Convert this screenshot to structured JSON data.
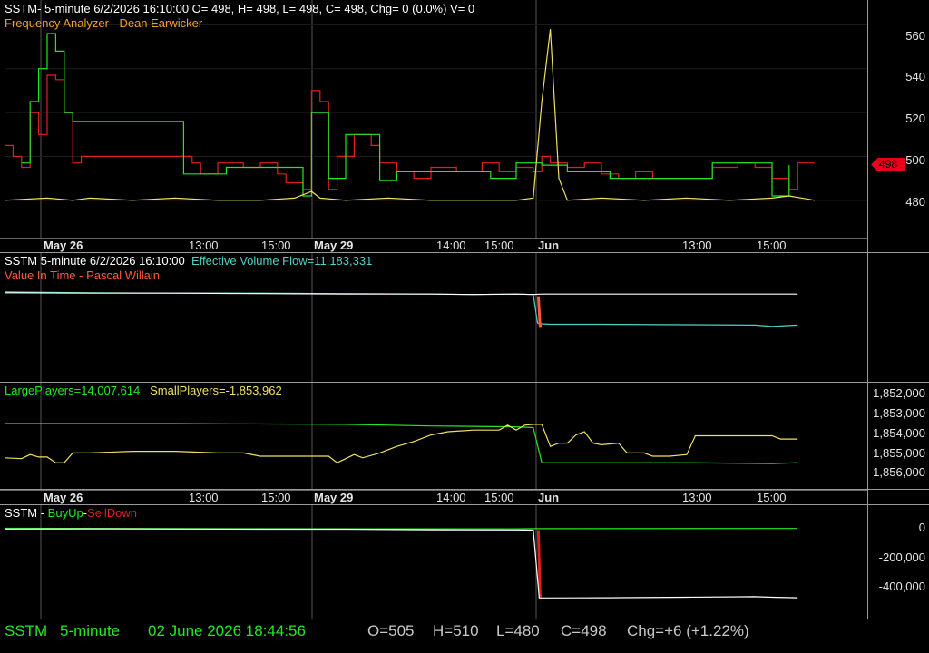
{
  "colors": {
    "background": "#000000",
    "green": "#22e822",
    "red": "#e02020",
    "yellow": "#f0e060",
    "orange": "#f0a030",
    "cyan": "#4fd1c5",
    "white": "#ffffff",
    "grid": "#555555",
    "salmon": "#ff5a3c"
  },
  "header": {
    "title_line": "SSTM- 5-minute 6/2/2026 16:10:00 O= 498, H= 498, L= 498, C= 498, Chg= 0 (0.0%) V= 0",
    "subtitle": "Frequency Analyzer - Dean Earwicker"
  },
  "pane2": {
    "line1_symbol": "SSTM 5-minute  6/2/2026 16:10:00",
    "line1_indicator": "Effective Volume Flow=11,183,331",
    "line2": "Value In Time - Pascal Willain"
  },
  "pane3": {
    "large_label": "LargePlayers=14,007,614",
    "small_label": "SmallPlayers=-1,853,962"
  },
  "pane4": {
    "symbol": "SSTM - ",
    "buyup": "BuyUp",
    "dash": "-",
    "selldown": "SellDown"
  },
  "price_axis": {
    "ticks": [
      "560",
      "540",
      "520",
      "500",
      "480"
    ],
    "last_price": "498"
  },
  "players_axis": {
    "ticks": [
      "1,852,000",
      "1,853,000",
      "1,854,000",
      "1,855,000",
      "1,856,000"
    ]
  },
  "buysell_axis": {
    "ticks": [
      "0",
      "-200,000",
      "-400,000"
    ]
  },
  "x_axis_labels": [
    "May 26",
    "13:00",
    "15:00",
    "May 29",
    "14:00",
    "15:00",
    "Jun",
    "13:00",
    "15:00"
  ],
  "status_bar": {
    "symbol": "SSTM",
    "interval": "5-minute",
    "datetime": "02 June 2026 18:44:56",
    "open": "O=505",
    "high": "H=510",
    "low": "L=480",
    "close": "C=498",
    "change": "Chg=+6 (+1.22%)"
  },
  "chart_data": [
    {
      "type": "line",
      "title": "Frequency Analyzer - Dean Earwicker",
      "ylim": [
        470,
        568
      ],
      "x_range": [
        0,
        100
      ],
      "series": [
        {
          "name": "",
          "color": "red",
          "step": true,
          "points": [
            [
              0,
              505
            ],
            [
              1,
              500
            ],
            [
              2,
              495
            ],
            [
              3,
              520
            ],
            [
              4,
              510
            ],
            [
              5,
              537
            ],
            [
              6,
              535
            ],
            [
              7,
              520
            ],
            [
              8,
              497
            ],
            [
              9,
              500
            ],
            [
              12,
              500
            ],
            [
              18,
              500
            ],
            [
              22,
              497
            ],
            [
              23,
              492
            ],
            [
              25,
              497
            ],
            [
              28,
              495
            ],
            [
              30,
              497
            ],
            [
              32,
              492
            ],
            [
              33,
              488
            ],
            [
              35,
              485
            ],
            [
              36,
              530
            ],
            [
              37,
              525
            ],
            [
              38,
              485
            ],
            [
              39,
              500
            ],
            [
              41,
              510
            ],
            [
              43,
              505
            ],
            [
              44,
              497
            ],
            [
              46,
              493
            ],
            [
              48,
              490
            ],
            [
              50,
              495
            ],
            [
              53,
              493
            ],
            [
              56,
              497
            ],
            [
              58,
              493
            ],
            [
              60,
              495
            ],
            [
              62,
              493
            ],
            [
              63,
              500
            ],
            [
              64,
              497
            ],
            [
              66,
              495
            ],
            [
              68,
              497
            ],
            [
              70,
              492
            ],
            [
              72,
              490
            ],
            [
              74,
              493
            ],
            [
              76,
              490
            ],
            [
              80,
              490
            ],
            [
              83,
              495
            ],
            [
              86,
              497
            ],
            [
              88,
              495
            ],
            [
              90,
              490
            ],
            [
              92,
              485
            ],
            [
              93,
              497
            ],
            [
              95,
              497
            ]
          ]
        },
        {
          "name": "",
          "color": "green",
          "step": true,
          "points": [
            [
              2,
              497
            ],
            [
              3,
              525
            ],
            [
              4,
              540
            ],
            [
              5,
              556
            ],
            [
              6,
              548
            ],
            [
              7,
              520
            ],
            [
              8,
              516
            ],
            [
              21,
              492
            ],
            [
              26,
              495
            ],
            [
              35,
              482
            ],
            [
              36,
              520
            ],
            [
              38,
              490
            ],
            [
              40,
              510
            ],
            [
              44,
              489
            ],
            [
              46,
              493
            ],
            [
              57,
              490
            ],
            [
              60,
              497
            ],
            [
              63,
              496
            ],
            [
              66,
              493
            ],
            [
              71,
              490
            ],
            [
              83,
              497
            ],
            [
              90,
              482
            ],
            [
              92,
              496
            ]
          ]
        },
        {
          "name": "",
          "color": "yellow",
          "step": false,
          "points": [
            [
              0,
              480
            ],
            [
              5,
              481
            ],
            [
              8,
              480
            ],
            [
              10,
              481
            ],
            [
              15,
              480
            ],
            [
              20,
              481
            ],
            [
              25,
              480
            ],
            [
              30,
              480
            ],
            [
              34,
              481
            ],
            [
              36,
              484
            ],
            [
              37,
              481
            ],
            [
              40,
              480
            ],
            [
              45,
              481
            ],
            [
              50,
              480
            ],
            [
              55,
              480
            ],
            [
              60,
              480
            ],
            [
              62,
              481
            ],
            [
              63,
              525
            ],
            [
              64,
              558
            ],
            [
              65,
              490
            ],
            [
              66,
              480
            ],
            [
              70,
              481
            ],
            [
              75,
              480
            ],
            [
              80,
              481
            ],
            [
              85,
              480
            ],
            [
              90,
              481
            ],
            [
              92,
              482
            ],
            [
              95,
              480
            ]
          ]
        }
      ]
    },
    {
      "type": "line",
      "title": "Value In Time - Pascal Willain",
      "ylim": [
        -16000000,
        2000000
      ],
      "x_range": [
        0,
        100
      ],
      "series": [
        {
          "name": "Effective Volume Flow",
          "color": "cyan",
          "points": [
            [
              0,
              0
            ],
            [
              10,
              -200000
            ],
            [
              20,
              -300000
            ],
            [
              30,
              -300000
            ],
            [
              40,
              -400000
            ],
            [
              50,
              -500000
            ],
            [
              55,
              -600000
            ],
            [
              60,
              -500000
            ],
            [
              62,
              -600000
            ],
            [
              62.5,
              -7000000
            ],
            [
              63,
              -7200000
            ],
            [
              64,
              -7300000
            ],
            [
              70,
              -7300000
            ],
            [
              80,
              -7400000
            ],
            [
              88,
              -7500000
            ],
            [
              90,
              -7800000
            ],
            [
              93,
              -7500000
            ]
          ]
        },
        {
          "name": "",
          "color": "white",
          "points": [
            [
              0,
              -200000
            ],
            [
              10,
              -300000
            ],
            [
              20,
              -300000
            ],
            [
              30,
              -400000
            ],
            [
              40,
              -500000
            ],
            [
              50,
              -500000
            ],
            [
              55,
              -600000
            ],
            [
              60,
              -500000
            ],
            [
              62,
              -600000
            ],
            [
              63,
              -500000
            ],
            [
              70,
              -500000
            ],
            [
              80,
              -500000
            ],
            [
              90,
              -500000
            ],
            [
              93,
              -500000
            ]
          ]
        },
        {
          "name": "",
          "color": "salmon",
          "points": [
            [
              62.6,
              -1000000
            ],
            [
              62.8,
              -7800000
            ],
            [
              63,
              -7800000
            ]
          ]
        }
      ]
    },
    {
      "type": "line",
      "title": "",
      "ylim": [
        1856500,
        1851500
      ],
      "x_range": [
        0,
        100
      ],
      "series": [
        {
          "name": "LargePlayers",
          "color": "green",
          "points": [
            [
              0,
              1853000
            ],
            [
              20,
              1853000
            ],
            [
              40,
              1853050
            ],
            [
              50,
              1853150
            ],
            [
              60,
              1853200
            ],
            [
              62,
              1853250
            ],
            [
              63,
              1855400
            ],
            [
              70,
              1855400
            ],
            [
              80,
              1855400
            ],
            [
              90,
              1855450
            ],
            [
              93,
              1855400
            ]
          ]
        },
        {
          "name": "SmallPlayers",
          "color": "yellow",
          "points": [
            [
              0,
              1855100
            ],
            [
              2,
              1855150
            ],
            [
              3,
              1854900
            ],
            [
              4,
              1855050
            ],
            [
              5,
              1855050
            ],
            [
              6,
              1855400
            ],
            [
              7,
              1855400
            ],
            [
              8,
              1854800
            ],
            [
              10,
              1854800
            ],
            [
              15,
              1854700
            ],
            [
              20,
              1854700
            ],
            [
              25,
              1854800
            ],
            [
              28,
              1854800
            ],
            [
              30,
              1855000
            ],
            [
              35,
              1855000
            ],
            [
              38,
              1855000
            ],
            [
              39,
              1855400
            ],
            [
              41,
              1854900
            ],
            [
              42,
              1855100
            ],
            [
              44,
              1854800
            ],
            [
              46,
              1854400
            ],
            [
              48,
              1854100
            ],
            [
              50,
              1853700
            ],
            [
              52,
              1853500
            ],
            [
              55,
              1853400
            ],
            [
              58,
              1853400
            ],
            [
              59,
              1853100
            ],
            [
              60,
              1853400
            ],
            [
              61,
              1853100
            ],
            [
              62,
              1853050
            ],
            [
              63,
              1853050
            ],
            [
              64,
              1854400
            ],
            [
              65,
              1854200
            ],
            [
              66,
              1854200
            ],
            [
              67,
              1853700
            ],
            [
              68,
              1853500
            ],
            [
              69,
              1854200
            ],
            [
              70,
              1854300
            ],
            [
              72,
              1854200
            ],
            [
              73,
              1854800
            ],
            [
              75,
              1854800
            ],
            [
              76,
              1855000
            ],
            [
              78,
              1855000
            ],
            [
              80,
              1854900
            ],
            [
              81,
              1853750
            ],
            [
              85,
              1853750
            ],
            [
              90,
              1853750
            ],
            [
              91,
              1853950
            ],
            [
              93,
              1853950
            ]
          ]
        }
      ]
    },
    {
      "type": "line",
      "title": "",
      "ylim": [
        -460000,
        60000
      ],
      "x_range": [
        0,
        100
      ],
      "series": [
        {
          "name": "BuyUp",
          "color": "green",
          "points": [
            [
              0,
              0
            ],
            [
              20,
              -2000
            ],
            [
              40,
              -3000
            ],
            [
              60,
              -3000
            ],
            [
              62,
              -2000
            ],
            [
              93,
              -1000
            ]
          ]
        },
        {
          "name": "SellDown",
          "color": "red",
          "points": [
            [
              62.6,
              -10000
            ],
            [
              62.8,
              -360000
            ],
            [
              63.0,
              -360000
            ]
          ]
        },
        {
          "name": "",
          "color": "white",
          "points": [
            [
              0,
              -4000
            ],
            [
              10,
              -3000
            ],
            [
              20,
              -4000
            ],
            [
              30,
              -5000
            ],
            [
              40,
              -5000
            ],
            [
              50,
              -8000
            ],
            [
              60,
              -9000
            ],
            [
              62,
              -10000
            ],
            [
              62.7,
              -370000
            ],
            [
              63,
              -370000
            ],
            [
              70,
              -369000
            ],
            [
              80,
              -366000
            ],
            [
              88,
              -363000
            ],
            [
              90,
              -366000
            ],
            [
              93,
              -369000
            ]
          ]
        }
      ]
    }
  ]
}
